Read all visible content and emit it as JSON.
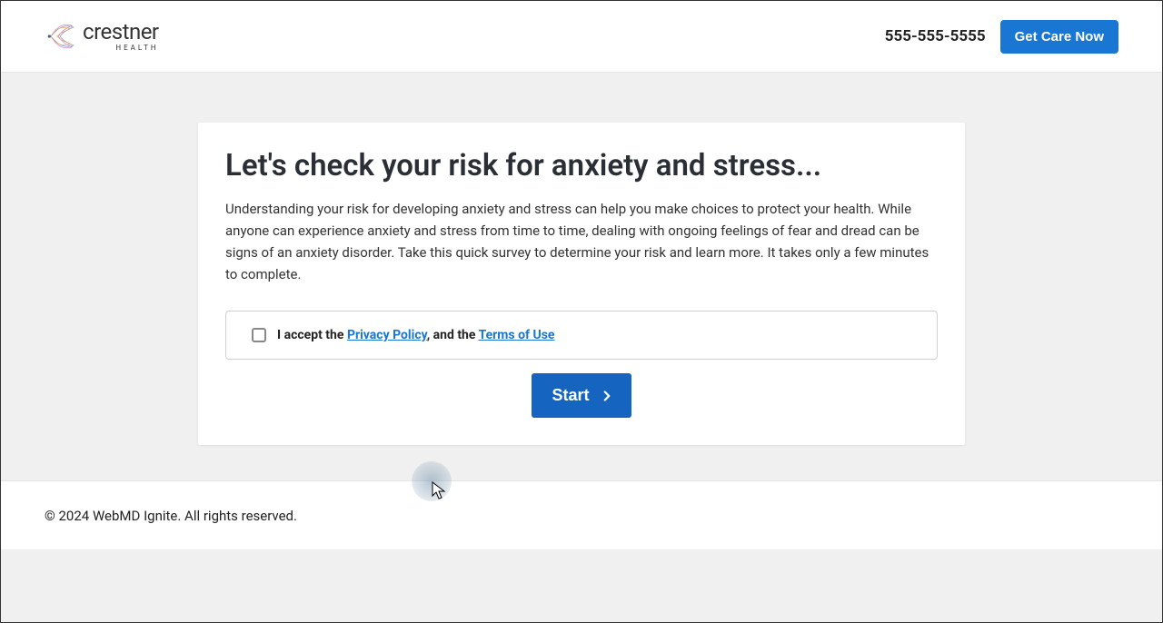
{
  "header": {
    "logo_name": "crestner",
    "logo_sub": "HEALTH",
    "phone": "555-555-5555",
    "get_care_label": "Get Care Now"
  },
  "card": {
    "title": "Let's check your risk for anxiety and stress...",
    "description": "Understanding your risk for developing anxiety and stress can help you make choices to protect your health. While anyone can experience anxiety and stress from time to time, dealing with ongoing feelings of fear and dread can be signs of an anxiety disorder. Take this quick survey to determine your risk and learn more. It takes only a few minutes to complete.",
    "consent_prefix": "I accept the ",
    "privacy_link": "Privacy Policy",
    "consent_mid": ", and the ",
    "terms_link": "Terms of Use",
    "start_label": "Start"
  },
  "footer": {
    "copyright": "© 2024 WebMD Ignite. All rights reserved."
  }
}
